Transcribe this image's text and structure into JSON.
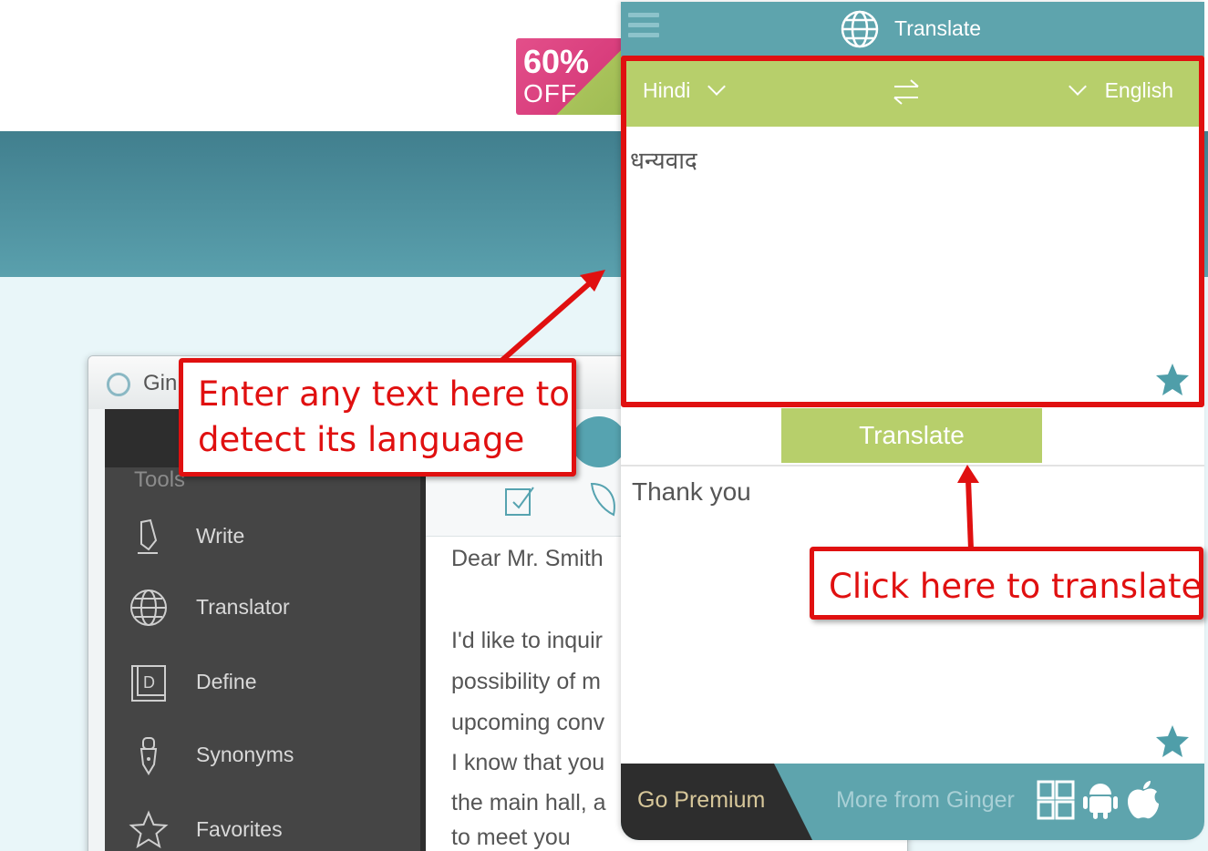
{
  "promo": {
    "percent": "60%",
    "off": "OFF"
  },
  "desktop_app": {
    "title": "Gin",
    "section_label": "Tools",
    "menu": [
      {
        "label": "Write",
        "icon": "pen-icon"
      },
      {
        "label": "Translator",
        "icon": "globe-icon"
      },
      {
        "label": "Define",
        "icon": "dictionary-icon"
      },
      {
        "label": "Synonyms",
        "icon": "fountain-pen-icon"
      },
      {
        "label": "Favorites",
        "icon": "star-icon"
      }
    ],
    "document_lines": [
      "Dear Mr. Smith",
      "I'd like to inquir",
      "possibility of m",
      "upcoming conv",
      "I know that you",
      "the main hall, a",
      "to meet you"
    ]
  },
  "translate_panel": {
    "header_title": "Translate",
    "source_language": "Hindi",
    "target_language": "English",
    "source_text": "धन्यवाद",
    "translate_button": "Translate",
    "output_text": "Thank you",
    "footer": {
      "premium_label": "Go Premium",
      "more_label": "More from Ginger",
      "icons": [
        "windows-icon",
        "android-icon",
        "apple-icon"
      ]
    }
  },
  "annotations": {
    "callout_input": [
      "Enter any text here to",
      "detect its language"
    ],
    "callout_button": "Click here to translate",
    "color": "#e01010"
  },
  "colors": {
    "teal": "#5ea4ad",
    "green": "#b7cf6b",
    "dark": "#2d2d2d"
  }
}
